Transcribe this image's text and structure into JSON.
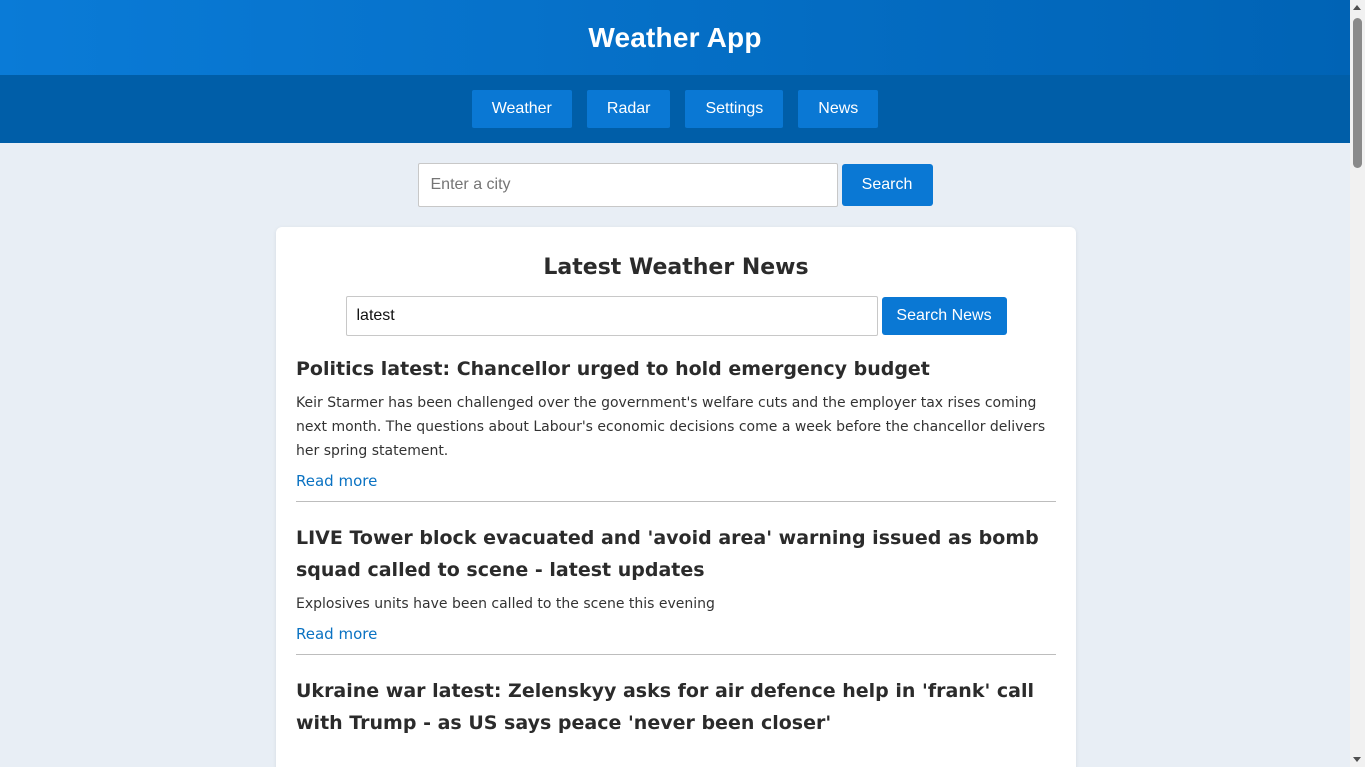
{
  "app": {
    "title": "Weather App"
  },
  "nav": {
    "items": [
      {
        "label": "Weather"
      },
      {
        "label": "Radar"
      },
      {
        "label": "Settings"
      },
      {
        "label": "News"
      }
    ]
  },
  "city_search": {
    "placeholder": "Enter a city",
    "value": "",
    "button_label": "Search"
  },
  "news": {
    "heading": "Latest Weather News",
    "search": {
      "value": "latest",
      "button_label": "Search News"
    },
    "articles": [
      {
        "title": "Politics latest: Chancellor urged to hold emergency budget",
        "summary": "Keir Starmer has been challenged over the government's welfare cuts and the employer tax rises coming next month. The questions about Labour's economic decisions come a week before the chancellor delivers her spring statement.",
        "link_label": "Read more"
      },
      {
        "title": "LIVE Tower block evacuated and 'avoid area' warning issued as bomb squad called to scene - latest updates",
        "summary": "Explosives units have been called to the scene this evening",
        "link_label": "Read more"
      },
      {
        "title": "Ukraine war latest: Zelenskyy asks for air defence help in 'frank' call with Trump - as US says peace 'never been closer'",
        "summary": "",
        "link_label": ""
      }
    ]
  },
  "colors": {
    "header_gradient_start": "#0a7bd7",
    "header_gradient_end": "#0063b5",
    "nav_bar": "#005ea8",
    "button": "#0a78d4",
    "link": "#0a72c2",
    "page_background": "#e8eef5"
  }
}
